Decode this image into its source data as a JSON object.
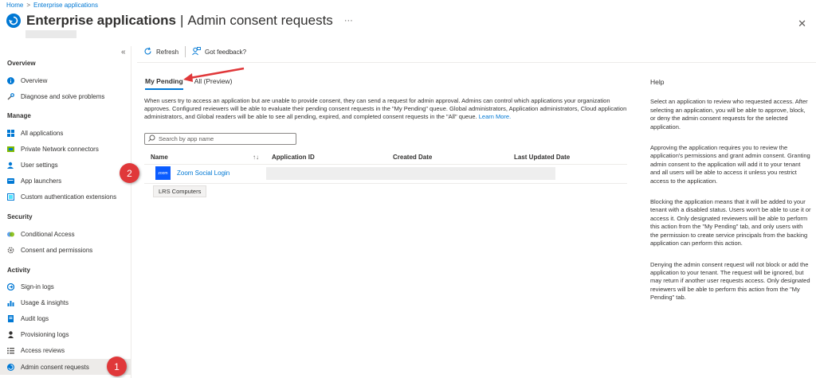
{
  "breadcrumb": {
    "home": "Home",
    "separator": ">",
    "current": "Enterprise applications"
  },
  "header": {
    "title_main": "Enterprise applications",
    "title_separator": "|",
    "title_sub": "Admin consent requests",
    "more": "···",
    "close": "✕"
  },
  "sidebar": {
    "collapse": "«",
    "sections": [
      {
        "heading": "Overview",
        "items": [
          {
            "label": "Overview",
            "icon": "info-icon"
          },
          {
            "label": "Diagnose and solve problems",
            "icon": "wrench-icon"
          }
        ]
      },
      {
        "heading": "Manage",
        "items": [
          {
            "label": "All applications",
            "icon": "grid-icon"
          },
          {
            "label": "Private Network connectors",
            "icon": "connector-icon"
          },
          {
            "label": "User settings",
            "icon": "user-settings-icon"
          },
          {
            "label": "App launchers",
            "icon": "launcher-icon"
          },
          {
            "label": "Custom authentication extensions",
            "icon": "extension-icon"
          }
        ]
      },
      {
        "heading": "Security",
        "items": [
          {
            "label": "Conditional Access",
            "icon": "conditional-access-icon"
          },
          {
            "label": "Consent and permissions",
            "icon": "gear-icon"
          }
        ]
      },
      {
        "heading": "Activity",
        "items": [
          {
            "label": "Sign-in logs",
            "icon": "sign-in-icon"
          },
          {
            "label": "Usage & insights",
            "icon": "chart-icon"
          },
          {
            "label": "Audit logs",
            "icon": "audit-icon"
          },
          {
            "label": "Provisioning logs",
            "icon": "person-icon"
          },
          {
            "label": "Access reviews",
            "icon": "list-icon"
          },
          {
            "label": "Admin consent requests",
            "icon": "consent-icon",
            "active": true
          }
        ]
      }
    ]
  },
  "toolbar": {
    "refresh": "Refresh",
    "feedback": "Got feedback?"
  },
  "tabs": [
    {
      "label": "My Pending",
      "active": true
    },
    {
      "label": "All (Preview)"
    }
  ],
  "description": {
    "text": "When users try to access an application but are unable to provide consent, they can send a request for admin approval. Admins can control which applications your organization approves. Configured reviewers will be able to evaluate their pending consent requests in the \"My Pending\" queue. Global administrators, Application administrators, Cloud application administrators, and Global readers will be able to see all pending, expired, and completed consent requests in the \"All\" queue.",
    "link": "Learn More."
  },
  "search": {
    "placeholder": "Search by app name"
  },
  "table": {
    "columns": [
      "Name",
      "Application ID",
      "Created Date",
      "Last Updated Date"
    ],
    "sort_glyph": "↑↓",
    "rows": [
      {
        "logo_text": "zoom",
        "name": "Zoom Social Login"
      }
    ],
    "tooltip": "LRS Computers"
  },
  "callouts": [
    "1",
    "2"
  ],
  "help": {
    "title": "Help",
    "paragraphs": [
      "Select an application to review who requested access. After selecting an application, you will be able to approve, block, or deny the admin consent requests for the selected application.",
      "Approving the application requires you to review the application's permissions and grant admin consent. Granting admin consent to the application will add it to your tenant and all users will be able to access it unless you restrict access to the application.",
      "Blocking the application means that it will be added to your tenant with a disabled status. Users won't be able to use it or access it. Only designated reviewers will be able to perform this action from the \"My Pending\" tab, and only users with the permission to create service principals from the backing application can perform this action.",
      "Denying the admin consent request will not block or add the application to your tenant. The request will be ignored, but may return if another user requests access. Only designated reviewers will be able to perform this action from the \"My Pending\" tab."
    ]
  },
  "colors": {
    "accent": "#0078d4",
    "callout": "#e0383a",
    "zoom": "#0b5cff",
    "active_nav": "#edebe9"
  }
}
